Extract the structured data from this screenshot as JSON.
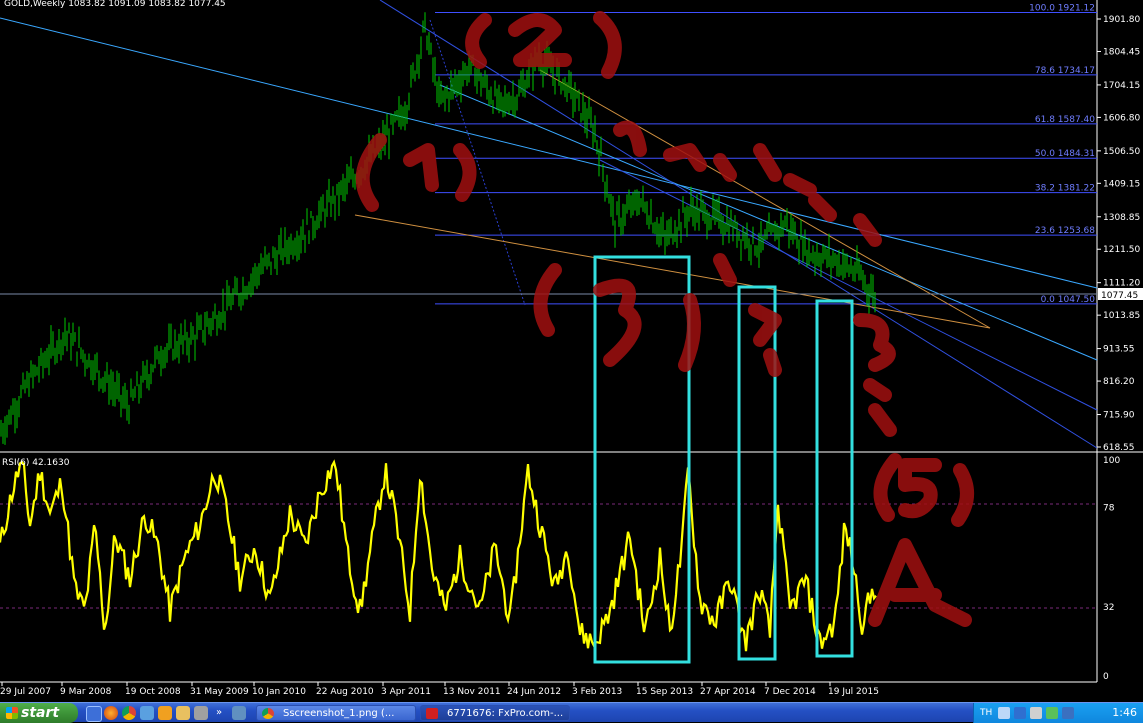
{
  "window": {
    "chart_title": "GOLD,Weekly  1083.82 1091.09 1083.82 1077.45",
    "rsi_title": "RSI(6) 42.1630"
  },
  "colors": {
    "background": "#000000",
    "candles": "#00c800",
    "rsi_line": "#ffff00",
    "fib_lines": "#3f4fff",
    "trend_lines": "#3aa8ff",
    "highlight_boxes": "#33e0e0",
    "annotation": "#a01010"
  },
  "price_axis": {
    "ticks": [
      "1901.80",
      "1804.45",
      "1704.15",
      "1606.80",
      "1506.50",
      "1409.15",
      "1308.85",
      "1211.50",
      "1111.20",
      "1013.85",
      "913.55",
      "816.20",
      "715.90",
      "618.55"
    ],
    "current_price": "1077.45"
  },
  "fib_levels": [
    {
      "label": "100.0 1921.12",
      "ratio": 1.0,
      "price": 1921.12
    },
    {
      "label": "78.6 1734.17",
      "ratio": 0.786,
      "price": 1734.17
    },
    {
      "label": "61.8 1587.40",
      "ratio": 0.618,
      "price": 1587.4
    },
    {
      "label": "50.0 1484.31",
      "ratio": 0.5,
      "price": 1484.31
    },
    {
      "label": "38.2 1381.22",
      "ratio": 0.382,
      "price": 1381.22
    },
    {
      "label": "23.6 1253.68",
      "ratio": 0.236,
      "price": 1253.68
    },
    {
      "label": "0.0 1047.50",
      "ratio": 0.0,
      "price": 1047.5
    }
  ],
  "rsi_axis": {
    "ticks": [
      "100",
      "78",
      "32",
      "0"
    ],
    "current": 42.163
  },
  "date_axis": {
    "ticks": [
      "29 Jul 2007",
      "9 Mar 2008",
      "19 Oct 2008",
      "31 May 2009",
      "10 Jan 2010",
      "22 Aug 2010",
      "3 Apr 2011",
      "13 Nov 2011",
      "24 Jun 2012",
      "3 Feb 2013",
      "15 Sep 2013",
      "27 Apr 2014",
      "7 Dec 2014",
      "19 Jul 2015"
    ]
  },
  "annotations": [
    "(1)",
    "(2)",
    "(3)",
    "(4)",
    "(5)",
    "(4)",
    "(5)",
    "(3)",
    "(4)",
    "(5)",
    "A"
  ],
  "taskbar": {
    "start_label": "start",
    "tasks": [
      {
        "label": "Sscreenshot_1.png (..."
      },
      {
        "label": "6771676: FxPro.com-..."
      }
    ],
    "tray_lang": "TH",
    "clock": "1:46"
  }
}
